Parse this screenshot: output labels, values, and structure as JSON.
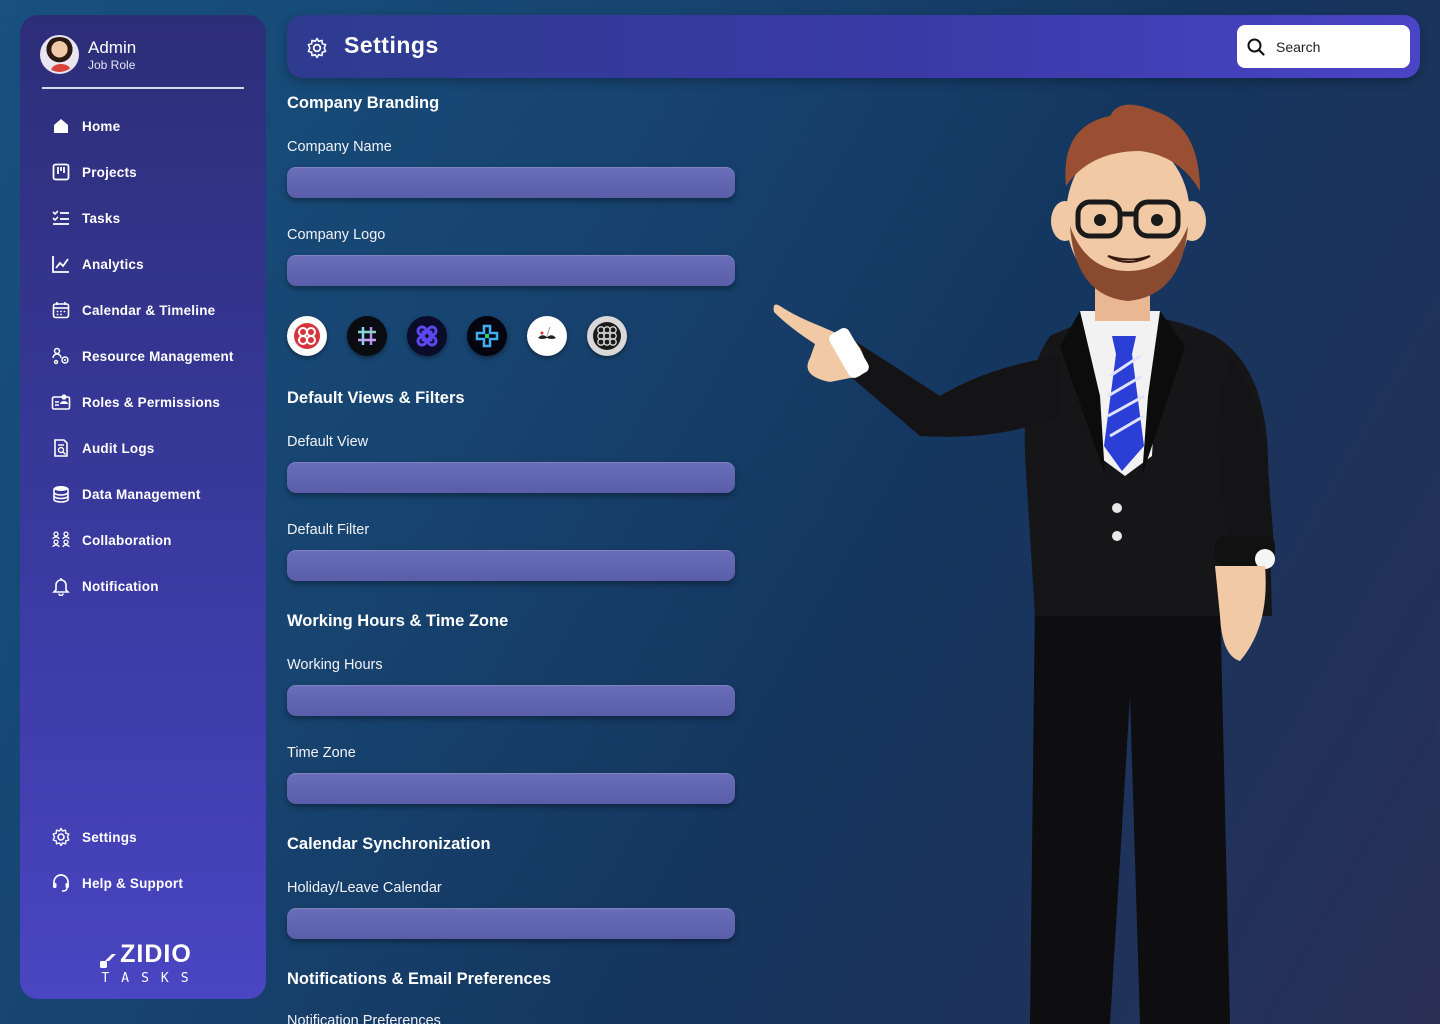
{
  "sidebar": {
    "profile": {
      "name": "Admin",
      "role": "Job Role"
    },
    "items": [
      {
        "label": "Home",
        "icon": "home-icon"
      },
      {
        "label": "Projects",
        "icon": "projects-icon"
      },
      {
        "label": "Tasks",
        "icon": "tasks-icon"
      },
      {
        "label": "Analytics",
        "icon": "analytics-icon"
      },
      {
        "label": "Calendar & Timeline",
        "icon": "calendar-icon"
      },
      {
        "label": "Resource Management",
        "icon": "resource-icon"
      },
      {
        "label": "Roles & Permissions",
        "icon": "roles-icon"
      },
      {
        "label": "Audit Logs",
        "icon": "audit-icon"
      },
      {
        "label": "Data Management",
        "icon": "database-icon"
      },
      {
        "label": "Collaboration",
        "icon": "collaboration-icon"
      },
      {
        "label": "Notification",
        "icon": "bell-icon"
      }
    ],
    "bottom_items": [
      {
        "label": "Settings",
        "icon": "gear-icon"
      },
      {
        "label": "Help & Support",
        "icon": "headset-icon"
      }
    ],
    "brand": {
      "name": "ZIDIO",
      "sub": "TASKS"
    }
  },
  "header": {
    "title": "Settings",
    "search_placeholder": "Search"
  },
  "sections": {
    "branding": {
      "title": "Company Branding",
      "company_name_label": "Company Name",
      "company_name_value": "",
      "company_logo_label": "Company Logo",
      "company_logo_value": ""
    },
    "views": {
      "title": "Default Views & Filters",
      "default_view_label": "Default View",
      "default_filter_label": "Default Filter"
    },
    "hours": {
      "title": "Working Hours & Time Zone",
      "working_hours_label": "Working Hours",
      "time_zone_label": "Time Zone"
    },
    "calendar": {
      "title": "Calendar Synchronization",
      "holiday_label": "Holiday/Leave Calendar"
    },
    "notifications": {
      "title": "Notifications & Email Preferences",
      "pref_label": "Notification Preferences"
    }
  },
  "colors": {
    "accent": "#4a45c2",
    "input_bg": "#6266b0",
    "background": "#17436f"
  }
}
